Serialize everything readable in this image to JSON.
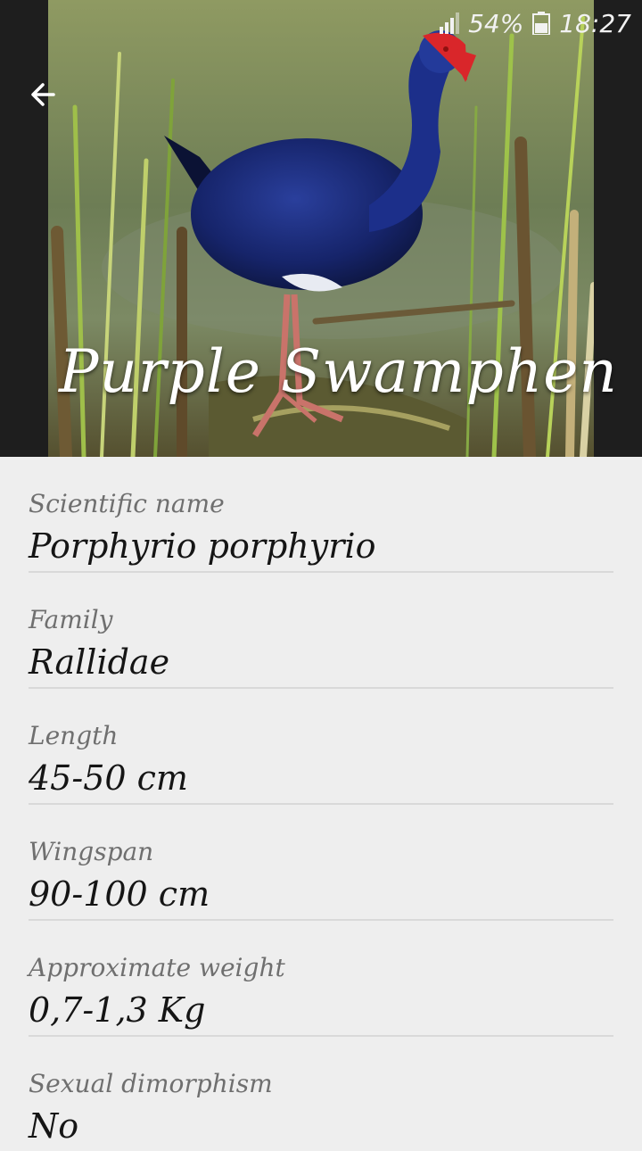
{
  "status": {
    "battery": "54%",
    "time": "18:27"
  },
  "header": {
    "title": "Purple Swamphen"
  },
  "details": [
    {
      "label": "Scientific name",
      "value": "Porphyrio porphyrio"
    },
    {
      "label": "Family",
      "value": "Rallidae"
    },
    {
      "label": "Length",
      "value": "45-50 cm"
    },
    {
      "label": "Wingspan",
      "value": "90-100 cm"
    },
    {
      "label": "Approximate weight",
      "value": "0,7-1,3 Kg"
    },
    {
      "label": "Sexual dimorphism",
      "value": "No"
    }
  ]
}
